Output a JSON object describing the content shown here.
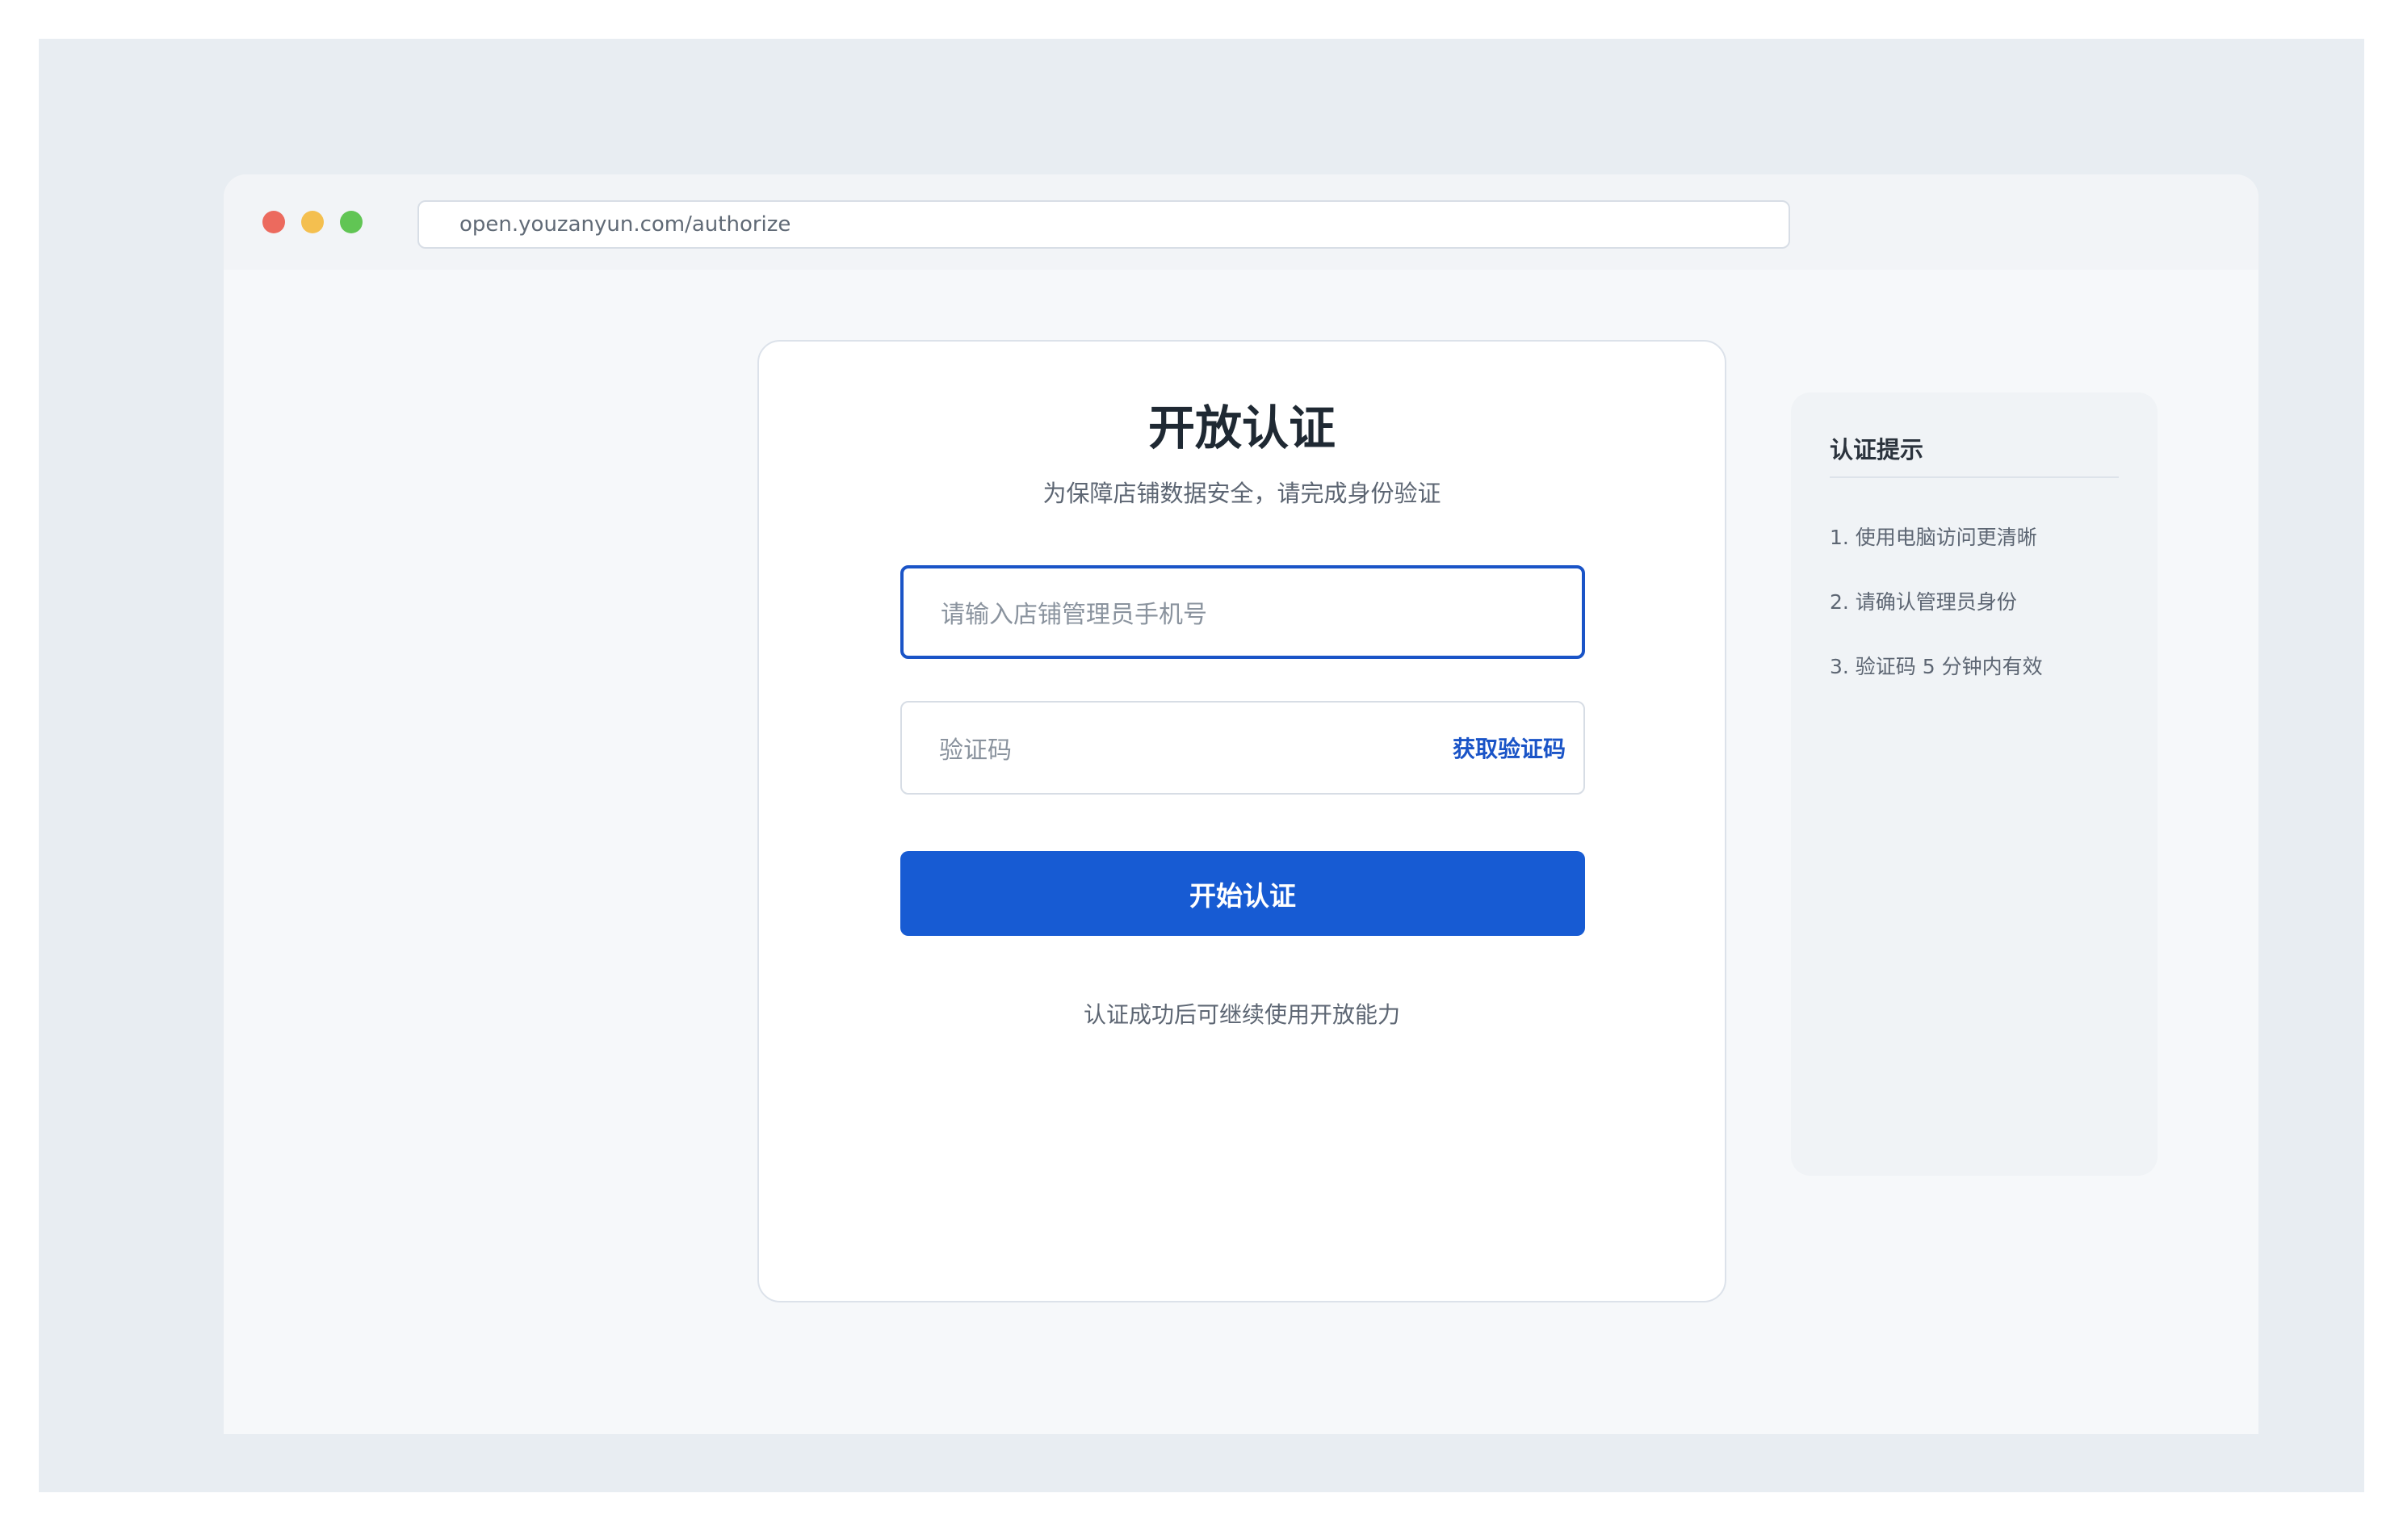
{
  "browser": {
    "url": "open.youzanyun.com/authorize",
    "traffic_lights": [
      "#ec6a5e",
      "#f4bf4f",
      "#61c554"
    ]
  },
  "form": {
    "title": "开放认证",
    "subtitle": "为保障店铺数据安全，请完成身份验证",
    "phone_placeholder": "请输入店铺管理员手机号",
    "code_placeholder": "验证码",
    "get_code_label": "获取验证码",
    "submit_label": "开始认证",
    "footnote": "认证成功后可继续使用开放能力"
  },
  "tips": {
    "title": "认证提示",
    "items": [
      "1. 使用电脑访问更清晰",
      "2. 请确认管理员身份",
      "3. 验证码 5 分钟内有效"
    ]
  },
  "colors": {
    "accent": "#175bd3",
    "focus_border": "#1a54c7",
    "backdrop": "#e8edf2"
  }
}
